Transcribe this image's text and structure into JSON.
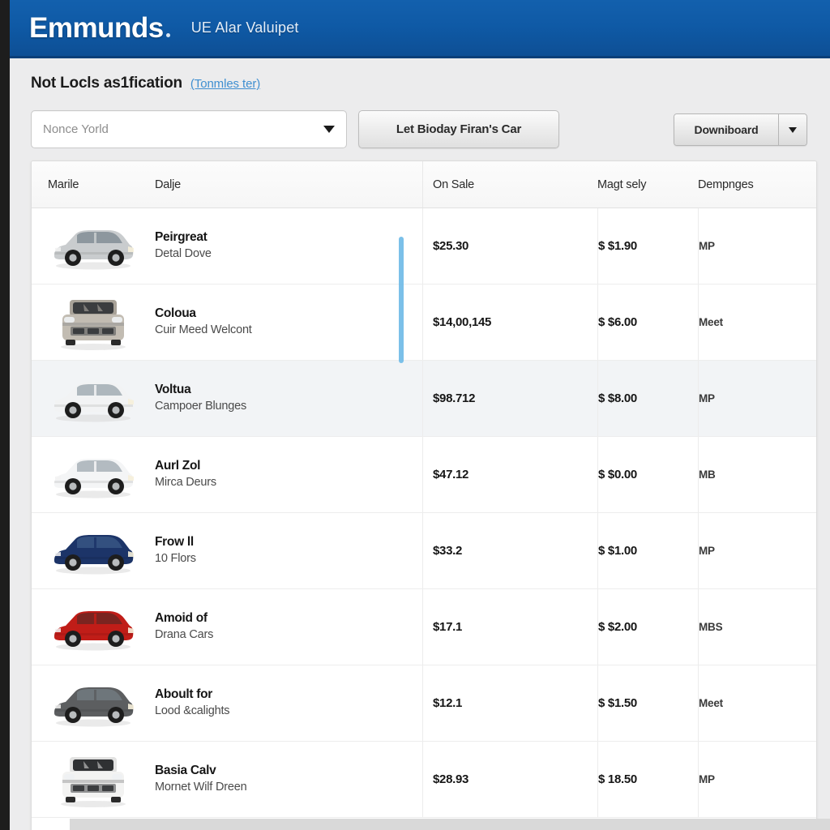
{
  "header": {
    "brand": "Emmunds",
    "tagline": "UE Alar Valuipet",
    "bar_color": "#0f5aa6"
  },
  "page": {
    "title": "Not Locls as1fication",
    "link": "(Tonmles ter)"
  },
  "controls": {
    "location_select": {
      "value": "Nonce Yorld",
      "caret_icon": "chevron-down-icon"
    },
    "primary_button": "Let Bioday Firan's Car",
    "download_split": {
      "label": "Downiboard",
      "caret_icon": "chevron-down-icon"
    }
  },
  "table": {
    "columns": [
      "Marile",
      "Dalje",
      "On Sale",
      "Magt sely",
      "Dempnges"
    ],
    "selected_row_index": 2,
    "rows": [
      {
        "thumb": "silver-sedan-side",
        "name": "Peirgreat",
        "detail": "Detal Dove",
        "on_sale": "$25.30",
        "magt_sely": "$  $1.90",
        "dempnges": "MP"
      },
      {
        "thumb": "tan-suv-front",
        "name": "Coloua",
        "detail": "Cuir Meed Welcont",
        "on_sale": "$14,00,145",
        "magt_sely": "$  $6.00",
        "dempnges": "Meet"
      },
      {
        "thumb": "white-sedan-side",
        "name": "Voltua",
        "detail": "Campoer Blunges",
        "on_sale": "$98.712",
        "magt_sely": "$  $8.00",
        "dempnges": "MP"
      },
      {
        "thumb": "white-sedan-small",
        "name": "Aurl Zol",
        "detail": "Mirca Deurs",
        "on_sale": "$47.12",
        "magt_sely": "$  $0.00",
        "dempnges": "MB"
      },
      {
        "thumb": "blue-sedan-side",
        "name": "Frow ll",
        "detail": "10 Flors",
        "on_sale": "$33.2",
        "magt_sely": "$  $1.00",
        "dempnges": "MP"
      },
      {
        "thumb": "red-sedan-front",
        "name": "Amoid of",
        "detail": "Drana Cars",
        "on_sale": "$17.1",
        "magt_sely": "$  $2.00",
        "dempnges": "MBS"
      },
      {
        "thumb": "gray-sedan-side",
        "name": "Aboult for",
        "detail": "Lood &calights",
        "on_sale": "$12.1",
        "magt_sely": "$  $1.50",
        "dempnges": "Meet"
      },
      {
        "thumb": "white-suv-front",
        "name": "Basia Calv",
        "detail": "Mornet Wilf Dreen",
        "on_sale": "$28.93",
        "magt_sely": "$  18.50",
        "dempnges": "MP"
      }
    ]
  },
  "scrollbar": {
    "accent_color": "#74bde8"
  }
}
